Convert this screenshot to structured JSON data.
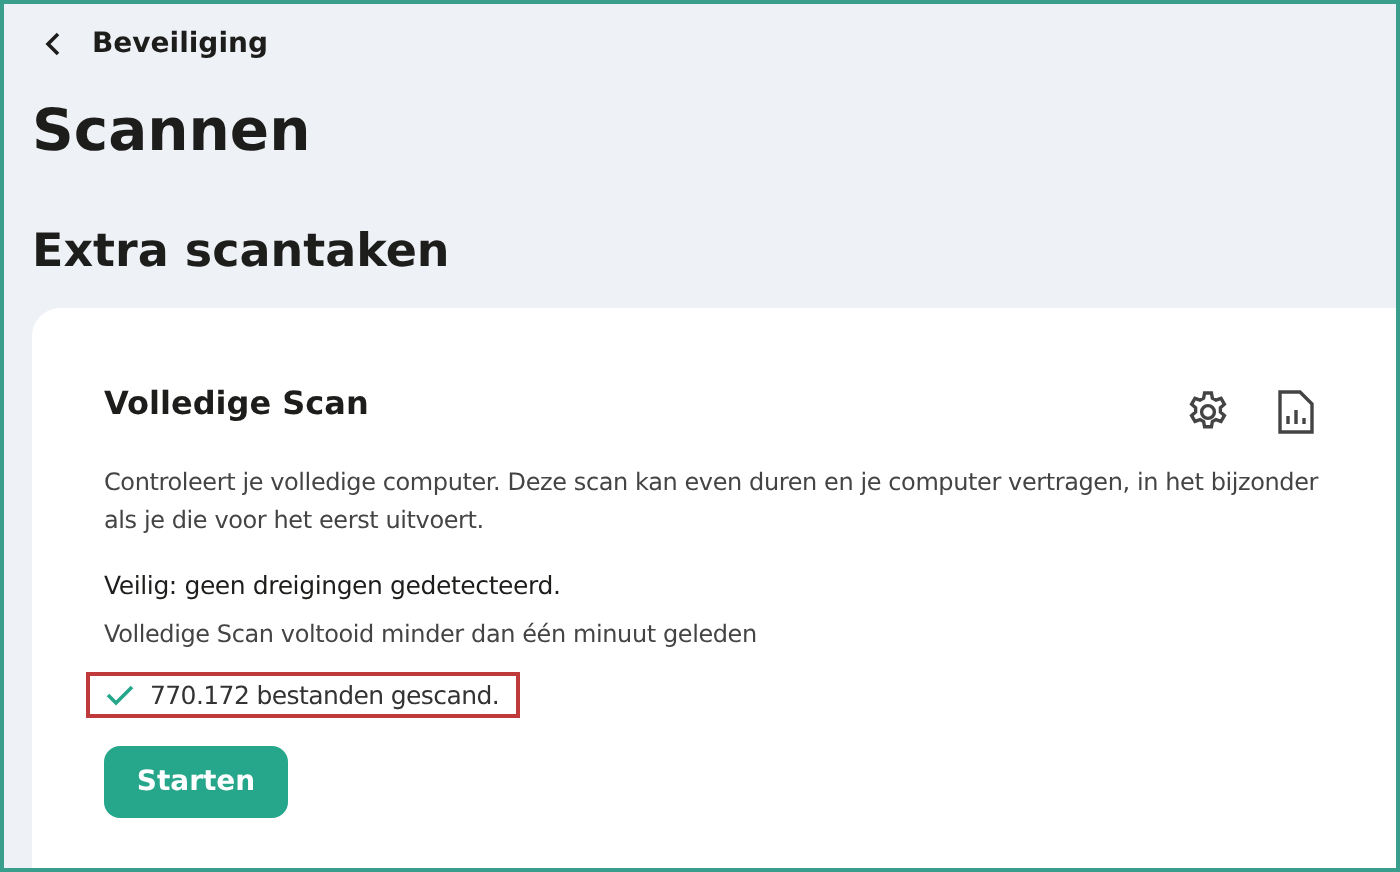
{
  "breadcrumb": {
    "label": "Beveiliging"
  },
  "page_title": "Scannen",
  "section_title": "Extra scantaken",
  "card": {
    "title": "Volledige Scan",
    "description": "Controleert je volledige computer. Deze scan kan even duren en je computer vertragen, in het bijzonder als je die voor het eerst uitvoert.",
    "status": "Veilig: geen dreigingen gedetecteerd.",
    "last_scan": "Volledige Scan voltooid minder dan één minuut geleden",
    "result": {
      "text": "770.172 bestanden gescand.",
      "highlighted": true
    },
    "button": "Starten"
  }
}
